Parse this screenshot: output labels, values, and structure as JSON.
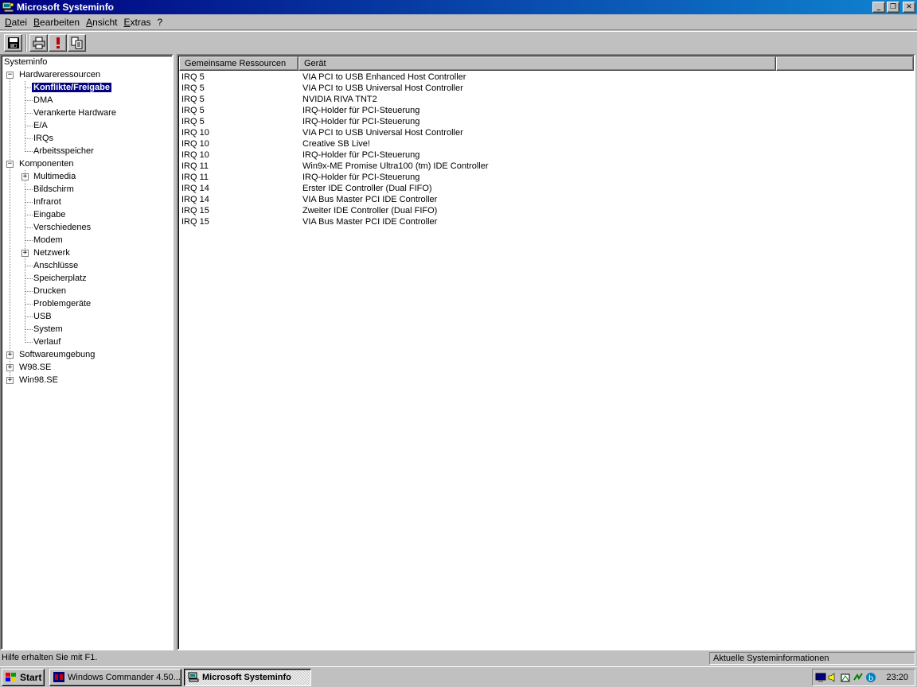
{
  "window": {
    "title": "Microsoft Systeminfo"
  },
  "menu": [
    "Datei",
    "Bearbeiten",
    "Ansicht",
    "Extras",
    "?"
  ],
  "tree": [
    {
      "label": "Systeminfo"
    },
    {
      "label": "Hardwareressourcen",
      "expander": "−"
    },
    {
      "label": "Konflikte/Freigabe",
      "selected": true
    },
    {
      "label": "DMA"
    },
    {
      "label": "Verankerte Hardware"
    },
    {
      "label": "E/A"
    },
    {
      "label": "IRQs"
    },
    {
      "label": "Arbeitsspeicher"
    },
    {
      "label": "Komponenten",
      "expander": "−"
    },
    {
      "label": "Multimedia",
      "expander": "+"
    },
    {
      "label": "Bildschirm"
    },
    {
      "label": "Infrarot"
    },
    {
      "label": "Eingabe"
    },
    {
      "label": "Verschiedenes"
    },
    {
      "label": "Modem"
    },
    {
      "label": "Netzwerk",
      "expander": "+"
    },
    {
      "label": "Anschlüsse"
    },
    {
      "label": "Speicherplatz"
    },
    {
      "label": "Drucken"
    },
    {
      "label": "Problemgeräte"
    },
    {
      "label": "USB"
    },
    {
      "label": "System"
    },
    {
      "label": "Verlauf"
    },
    {
      "label": "Softwareumgebung",
      "expander": "+"
    },
    {
      "label": "W98.SE",
      "expander": "+"
    },
    {
      "label": "Win98.SE",
      "expander": "+"
    }
  ],
  "list": {
    "columns": [
      "Gemeinsame Ressourcen",
      "Gerät",
      ""
    ],
    "rows": [
      [
        "IRQ 5",
        "VIA PCI to USB Enhanced Host Controller"
      ],
      [
        "IRQ 5",
        "VIA PCI to USB Universal Host Controller"
      ],
      [
        "IRQ 5",
        "NVIDIA RIVA TNT2"
      ],
      [
        "IRQ 5",
        "IRQ-Holder für PCI-Steuerung"
      ],
      [
        "IRQ 5",
        "IRQ-Holder für PCI-Steuerung"
      ],
      [
        "IRQ 10",
        "VIA PCI to USB Universal Host Controller"
      ],
      [
        "IRQ 10",
        "Creative SB Live!"
      ],
      [
        "IRQ 10",
        "IRQ-Holder für PCI-Steuerung"
      ],
      [
        "IRQ 11",
        "Win9x-ME Promise Ultra100 (tm) IDE Controller"
      ],
      [
        "IRQ 11",
        "IRQ-Holder für PCI-Steuerung"
      ],
      [
        "IRQ 14",
        "Erster IDE Controller (Dual FIFO)"
      ],
      [
        "IRQ 14",
        "VIA Bus Master PCI IDE Controller"
      ],
      [
        "IRQ 15",
        "Zweiter IDE Controller (Dual FIFO)"
      ],
      [
        "IRQ 15",
        "VIA Bus Master PCI IDE Controller"
      ]
    ]
  },
  "status": {
    "left": "Hilfe erhalten Sie mit F1.",
    "right": "Aktuelle Systeminformationen"
  },
  "taskbar": {
    "start": "Start",
    "tasks": [
      "Windows Commander 4.50...",
      "Microsoft Systeminfo"
    ],
    "clock": "23:20"
  },
  "colors": {
    "titlebar": "#000080",
    "face": "#c0c0c0",
    "selection": "#000080"
  },
  "icons": [
    "save-icon",
    "print-icon",
    "exclamation-icon",
    "copy-icon"
  ]
}
